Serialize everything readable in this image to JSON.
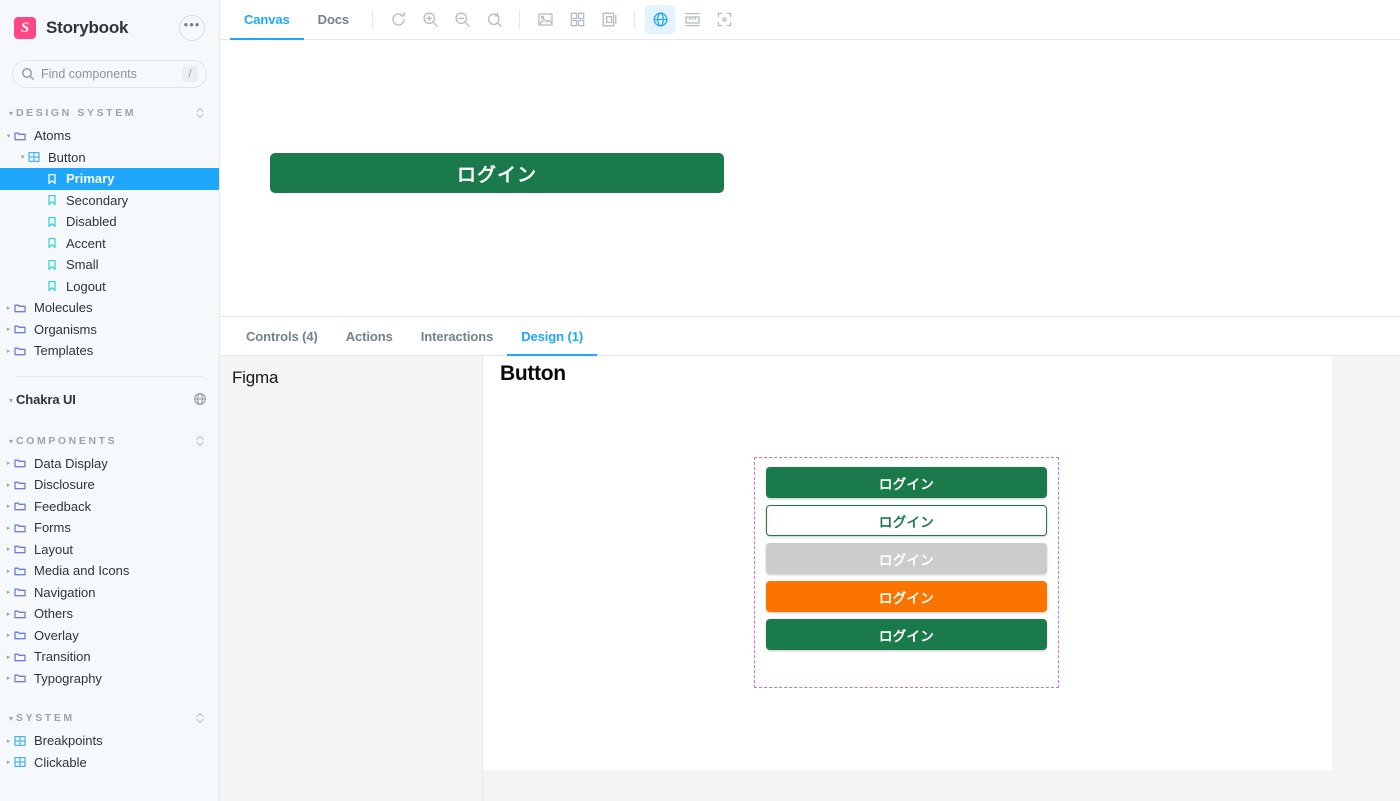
{
  "brand": {
    "logo_icon": "storybook-logo-icon",
    "logo_glyph": "S",
    "name": "Storybook",
    "menu_icon": "ellipsis-icon",
    "menu_glyph": "•••",
    "accent_color": "#ff4785",
    "active_color": "#1ea7fd"
  },
  "search": {
    "icon": "search-icon",
    "placeholder": "Find components",
    "value": "",
    "shortcut": "/"
  },
  "sidebar": {
    "sections": [
      {
        "label": "DESIGN SYSTEM",
        "caret": "▾",
        "action_icon": "expand-collapse-icon",
        "style": "caps",
        "nodes": [
          {
            "label": "Atoms",
            "level": 0,
            "icon": "folder-icon",
            "caret": "▾",
            "selected": false
          },
          {
            "label": "Button",
            "level": 1,
            "icon": "component-icon",
            "caret": "▾",
            "selected": false
          },
          {
            "label": "Primary",
            "level": 2,
            "icon": "story-icon",
            "caret": "",
            "selected": true
          },
          {
            "label": "Secondary",
            "level": 2,
            "icon": "story-icon",
            "caret": "",
            "selected": false
          },
          {
            "label": "Disabled",
            "level": 2,
            "icon": "story-icon",
            "caret": "",
            "selected": false
          },
          {
            "label": "Accent",
            "level": 2,
            "icon": "story-icon",
            "caret": "",
            "selected": false
          },
          {
            "label": "Small",
            "level": 2,
            "icon": "story-icon",
            "caret": "",
            "selected": false
          },
          {
            "label": "Logout",
            "level": 2,
            "icon": "story-icon",
            "caret": "",
            "selected": false
          },
          {
            "label": "Molecules",
            "level": 0,
            "icon": "folder-icon",
            "caret": "▸",
            "selected": false
          },
          {
            "label": "Organisms",
            "level": 0,
            "icon": "folder-icon",
            "caret": "▸",
            "selected": false
          },
          {
            "label": "Templates",
            "level": 0,
            "icon": "folder-icon",
            "caret": "▸",
            "selected": false
          }
        ]
      },
      {
        "label": "Chakra UI",
        "caret": "▾",
        "action_icon": "globe-icon",
        "style": "strong",
        "nodes": []
      },
      {
        "label": "COMPONENTS",
        "caret": "▾",
        "action_icon": "expand-collapse-icon",
        "style": "caps",
        "nodes": [
          {
            "label": "Data Display",
            "level": 0,
            "icon": "folder-icon",
            "caret": "▸",
            "selected": false
          },
          {
            "label": "Disclosure",
            "level": 0,
            "icon": "folder-icon",
            "caret": "▸",
            "selected": false
          },
          {
            "label": "Feedback",
            "level": 0,
            "icon": "folder-icon",
            "caret": "▸",
            "selected": false
          },
          {
            "label": "Forms",
            "level": 0,
            "icon": "folder-icon",
            "caret": "▸",
            "selected": false
          },
          {
            "label": "Layout",
            "level": 0,
            "icon": "folder-icon",
            "caret": "▸",
            "selected": false
          },
          {
            "label": "Media and Icons",
            "level": 0,
            "icon": "folder-icon",
            "caret": "▸",
            "selected": false
          },
          {
            "label": "Navigation",
            "level": 0,
            "icon": "folder-icon",
            "caret": "▸",
            "selected": false
          },
          {
            "label": "Others",
            "level": 0,
            "icon": "folder-icon",
            "caret": "▸",
            "selected": false
          },
          {
            "label": "Overlay",
            "level": 0,
            "icon": "folder-icon",
            "caret": "▸",
            "selected": false
          },
          {
            "label": "Transition",
            "level": 0,
            "icon": "folder-icon",
            "caret": "▸",
            "selected": false
          },
          {
            "label": "Typography",
            "level": 0,
            "icon": "folder-icon",
            "caret": "▸",
            "selected": false
          }
        ]
      },
      {
        "label": "SYSTEM",
        "caret": "▾",
        "action_icon": "expand-collapse-icon",
        "style": "caps",
        "nodes": [
          {
            "label": "Breakpoints",
            "level": 0,
            "icon": "component-icon",
            "caret": "▸",
            "selected": false
          },
          {
            "label": "Clickable",
            "level": 0,
            "icon": "component-icon",
            "caret": "▸",
            "selected": false
          }
        ]
      }
    ]
  },
  "toolbar": {
    "tabs": [
      {
        "label": "Canvas",
        "active": true
      },
      {
        "label": "Docs",
        "active": false
      }
    ],
    "buttons": [
      {
        "icon": "refresh-icon",
        "active": false
      },
      {
        "icon": "zoom-in-icon",
        "active": false
      },
      {
        "icon": "zoom-out-icon",
        "active": false
      },
      {
        "icon": "zoom-reset-icon",
        "active": false
      },
      {
        "icon": "background-icon",
        "active": false
      },
      {
        "icon": "grid-icon",
        "active": false
      },
      {
        "icon": "layers-icon",
        "active": false
      },
      {
        "icon": "globe-icon",
        "active": true
      },
      {
        "icon": "measure-icon",
        "active": false
      },
      {
        "icon": "outline-icon",
        "active": false
      }
    ]
  },
  "preview": {
    "story_button_label": "ログイン",
    "story_button_color": "#1b7a4b"
  },
  "panel": {
    "tabs": [
      {
        "label": "Controls (4)",
        "active": false
      },
      {
        "label": "Actions",
        "active": false
      },
      {
        "label": "Interactions",
        "active": false
      },
      {
        "label": "Design (1)",
        "active": true
      }
    ]
  },
  "figma": {
    "rail_title": "Figma",
    "frame_title": "Button",
    "selection_color": "#cc6fd8",
    "buttons": [
      {
        "label": "ログイン",
        "variant": "primary",
        "bg": "#1b7a4b",
        "fg": "#ffffff"
      },
      {
        "label": "ログイン",
        "variant": "secondary",
        "bg": "#ffffff",
        "fg": "#1b7a4b"
      },
      {
        "label": "ログイン",
        "variant": "disabled",
        "bg": "#cccccc",
        "fg": "#ffffff"
      },
      {
        "label": "ログイン",
        "variant": "accent",
        "bg": "#fc7400",
        "fg": "#ffffff"
      },
      {
        "label": "ログイン",
        "variant": "logout",
        "bg": "#1b7a4b",
        "fg": "#ffffff"
      }
    ]
  }
}
